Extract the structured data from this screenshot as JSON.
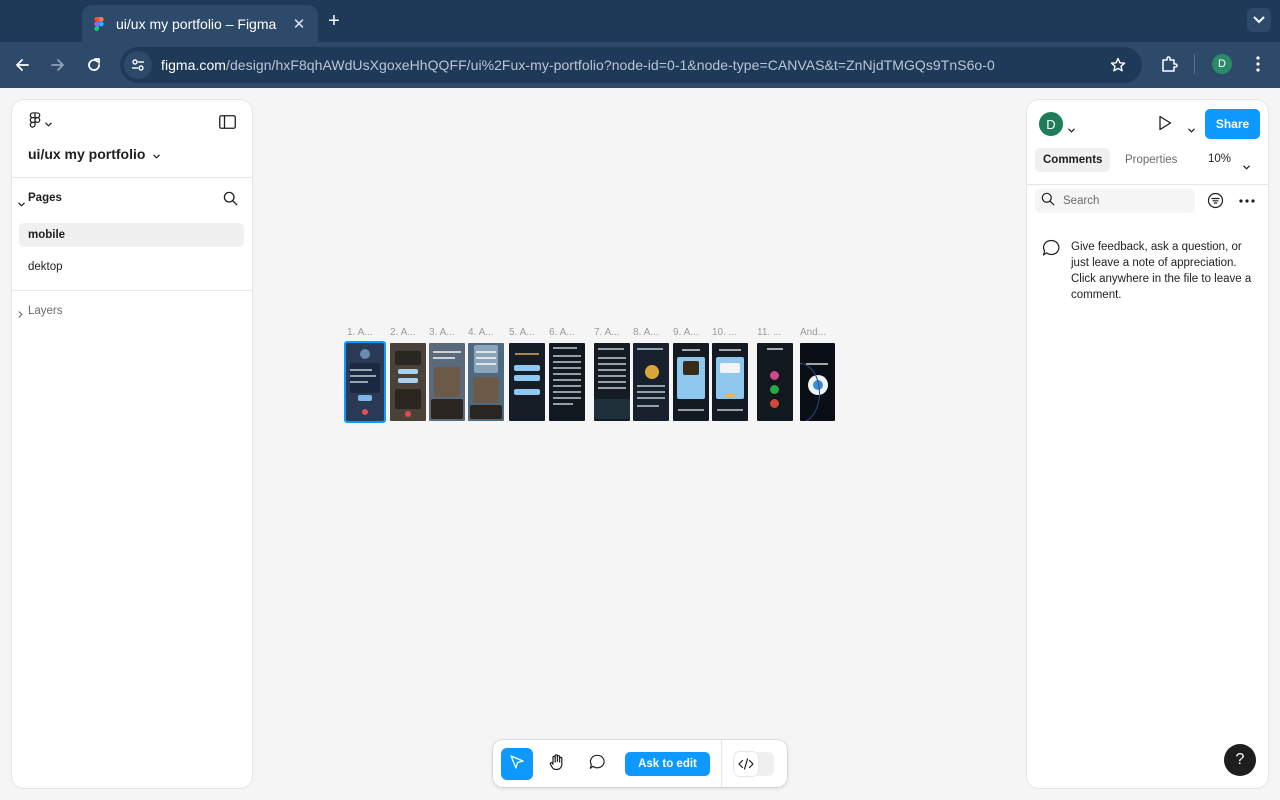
{
  "browser": {
    "tab_title": "ui/ux my portfolio – Figma",
    "tab_close": "✕",
    "new_tab": "+",
    "url_host": "figma.com",
    "url_path": "/design/hxF8qhAWdUsXgoxeHhQQFF/ui%2Fux-my-portfolio?node-id=0-1&node-type=CANVAS&t=ZnNjdTMGQs9TnS6o-0",
    "profile_initial": "D",
    "icons": [
      "back-arrow-icon",
      "forward-arrow-icon",
      "reload-icon",
      "site-info-icon",
      "bookmark-star-icon",
      "extensions-icon",
      "more-vertical-icon",
      "tab-search-icon"
    ]
  },
  "left_panel": {
    "file_name": "ui/ux my portfolio",
    "pages_label": "Pages",
    "pages": [
      {
        "name": "mobile",
        "active": true
      },
      {
        "name": "dektop",
        "active": false
      }
    ],
    "layers_label": "Layers"
  },
  "canvas": {
    "frames": [
      {
        "label": "1. A...",
        "bg": "#2a3a55",
        "selected": true
      },
      {
        "label": "2. A...",
        "bg": "#4a4238"
      },
      {
        "label": "3. A...",
        "bg": "#5a6a7a"
      },
      {
        "label": "4. A...",
        "bg": "#4e6a80"
      },
      {
        "label": "5. A...",
        "bg": "#151d27"
      },
      {
        "label": "6. A...",
        "bg": "#121820"
      },
      {
        "label": "7. A...",
        "bg": "#141b22"
      },
      {
        "label": "8. A...",
        "bg": "#17202c"
      },
      {
        "label": "9. A...",
        "bg": "#141a22"
      },
      {
        "label": "10. ...",
        "bg": "#141a22"
      },
      {
        "label": "11. ...",
        "bg": "#121820"
      },
      {
        "label": "And...",
        "bg": "#0a0f16"
      }
    ]
  },
  "right_panel": {
    "avatar_initial": "D",
    "share_label": "Share",
    "tabs": [
      "Comments",
      "Properties"
    ],
    "zoom": "10%",
    "search_placeholder": "Search",
    "empty_message": "Give feedback, ask a question, or just leave a note of appreciation. Click anywhere in the file to leave a comment."
  },
  "bottom_toolbar": {
    "ask_to_edit_label": "Ask to edit",
    "help_label": "?"
  },
  "colors": {
    "accent": "#0d99ff",
    "chrome_dark": "#1f3a58",
    "chrome_toolbar": "#2e4a6a",
    "avatar_green": "#1c7d58"
  }
}
